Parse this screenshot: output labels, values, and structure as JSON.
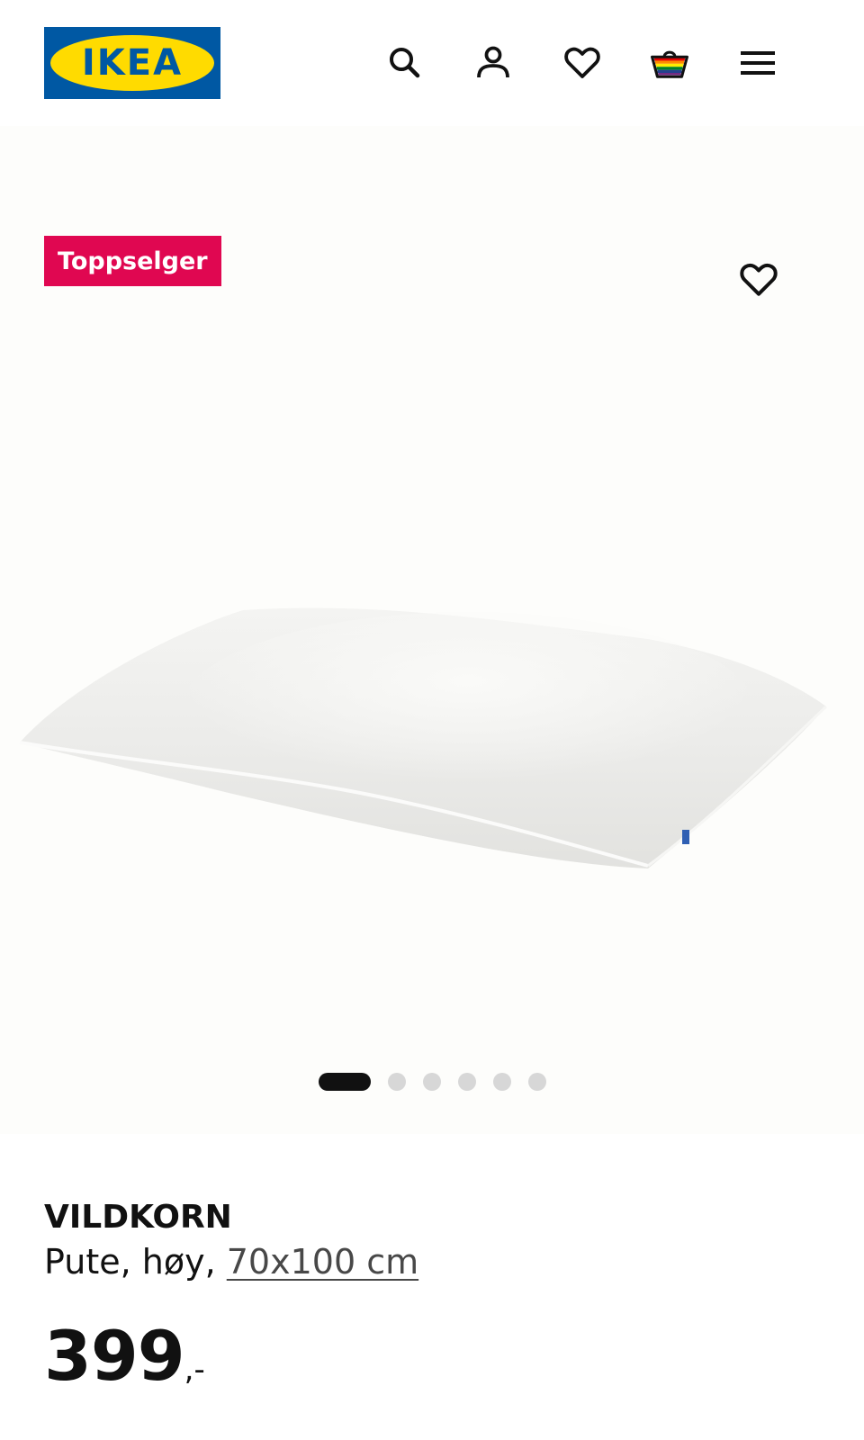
{
  "header": {
    "logo_text": "IKEA",
    "icons": [
      "search-icon",
      "account-icon",
      "favourites-icon",
      "shopping-basket-icon",
      "menu-icon"
    ]
  },
  "gallery": {
    "badge": "Toppselger",
    "favourite_icon": "heart-icon",
    "image_count": 6,
    "active_index": 0
  },
  "product": {
    "name": "VILDKORN",
    "description": "Pute, høy, ",
    "size": "70x100 cm",
    "price": "399",
    "price_suffix": ",-"
  },
  "colors": {
    "ikea_blue": "#0058a3",
    "ikea_yellow": "#ffdb00",
    "badge_red": "#e00751"
  }
}
